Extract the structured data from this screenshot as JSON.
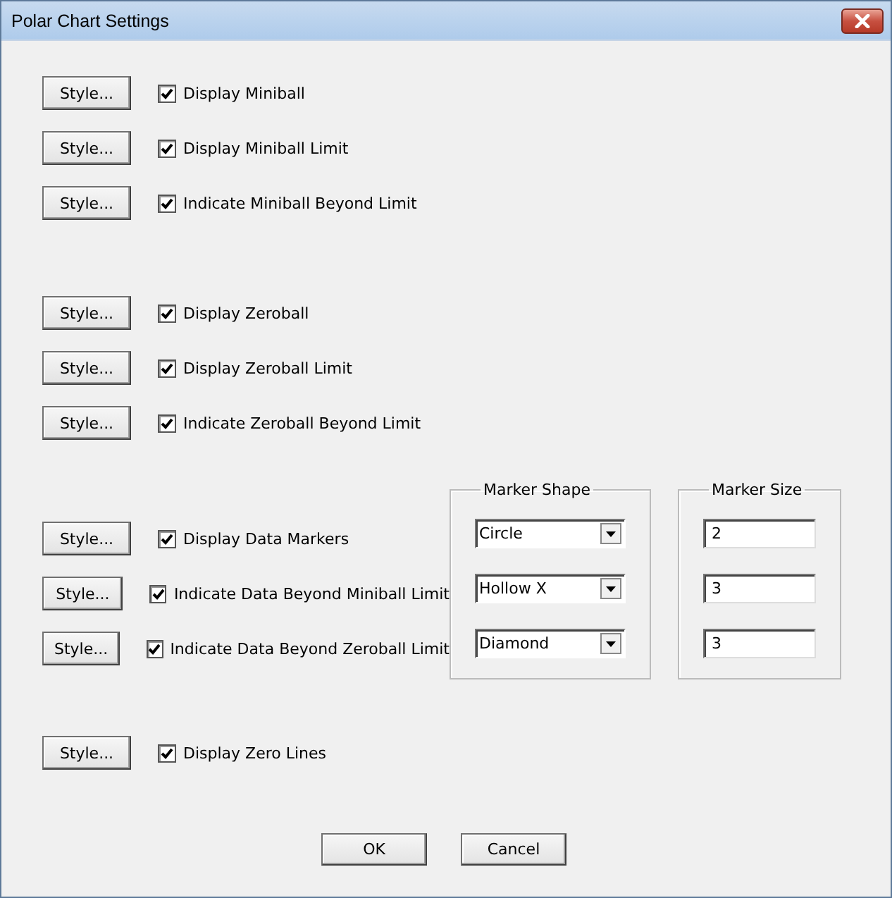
{
  "window": {
    "title": "Polar Chart Settings"
  },
  "sections": [
    {
      "rows": [
        {
          "button": "Style...",
          "label": "Display Miniball",
          "checked": true
        },
        {
          "button": "Style...",
          "label": "Display Miniball Limit",
          "checked": true
        },
        {
          "button": "Style...",
          "label": "Indicate Miniball Beyond Limit",
          "checked": true
        }
      ]
    },
    {
      "rows": [
        {
          "button": "Style...",
          "label": "Display Zeroball",
          "checked": true
        },
        {
          "button": "Style...",
          "label": "Display Zeroball Limit",
          "checked": true
        },
        {
          "button": "Style...",
          "label": "Indicate Zeroball Beyond Limit",
          "checked": true
        }
      ]
    },
    {
      "rows": [
        {
          "button": "Style...",
          "label": "Display Data Markers",
          "checked": true
        },
        {
          "button": "Style...",
          "label": "Indicate Data Beyond Miniball Limit",
          "checked": true
        },
        {
          "button": "Style...",
          "label": "Indicate Data Beyond Zeroball Limit",
          "checked": true
        }
      ],
      "marker_shape": {
        "title": "Marker Shape",
        "values": [
          "Circle",
          "Hollow X",
          "Diamond"
        ]
      },
      "marker_size": {
        "title": "Marker Size",
        "values": [
          "2",
          "3",
          "3"
        ]
      }
    },
    {
      "rows": [
        {
          "button": "Style...",
          "label": "Display Zero Lines",
          "checked": true
        }
      ]
    }
  ],
  "buttons": [
    "OK",
    "Cancel"
  ]
}
